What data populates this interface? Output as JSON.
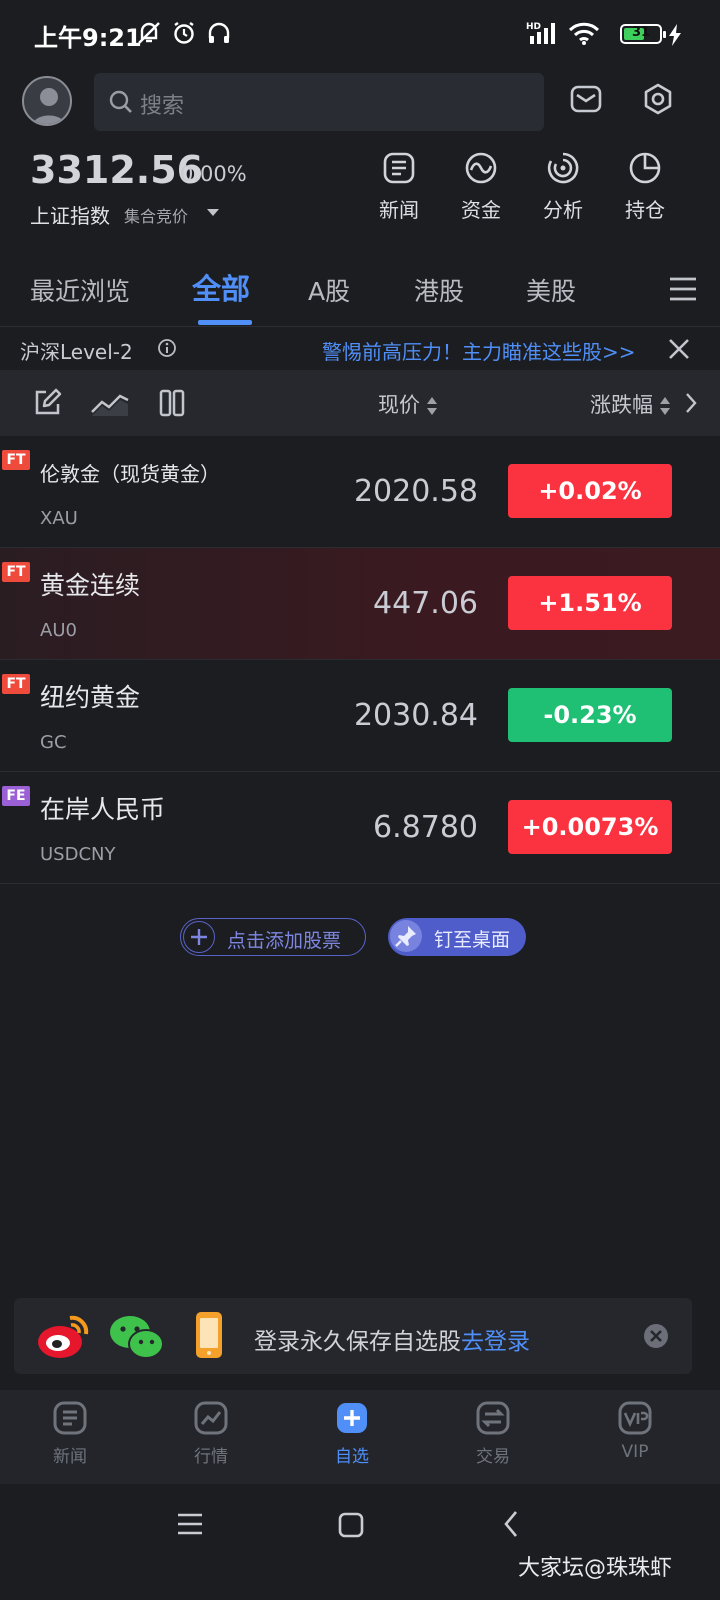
{
  "status_bar": {
    "time": "上午9:21",
    "signal": "HD",
    "battery": "31"
  },
  "header": {
    "search_placeholder": "搜索"
  },
  "index": {
    "value": "3312.56",
    "change": "0.00%",
    "name": "上证指数",
    "session": "集合竞价"
  },
  "quick_links": [
    {
      "label": "新闻",
      "icon": "news-icon"
    },
    {
      "label": "资金",
      "icon": "fund-flow-icon"
    },
    {
      "label": "分析",
      "icon": "analysis-icon"
    },
    {
      "label": "持仓",
      "icon": "holdings-pie-icon"
    }
  ],
  "tabs": [
    {
      "label": "最近浏览"
    },
    {
      "label": "全部",
      "active": true
    },
    {
      "label": "A股"
    },
    {
      "label": "港股"
    },
    {
      "label": "美股"
    }
  ],
  "level2": {
    "label": "沪深Level-2",
    "promo": "警惕前高压力！主力瞄准这些股>>"
  },
  "list_header": {
    "price": "现价",
    "change": "涨跌幅"
  },
  "rows": [
    {
      "tag": "FT",
      "name": "伦敦金（现货黄金）",
      "code": "XAU",
      "price": "2020.58",
      "change": "+0.02%",
      "direction": "up"
    },
    {
      "tag": "FT",
      "name": "黄金连续",
      "code": "AU0",
      "price": "447.06",
      "change": "+1.51%",
      "direction": "up"
    },
    {
      "tag": "FT",
      "name": "纽约黄金",
      "code": "GC",
      "price": "2030.84",
      "change": "-0.23%",
      "direction": "down"
    },
    {
      "tag": "FE",
      "name": "在岸人民币",
      "code": "USDCNY",
      "price": "6.8780",
      "change": "+0.0073%",
      "direction": "up"
    }
  ],
  "actions": {
    "add": "点击添加股票",
    "pin": "钉至桌面"
  },
  "banner": {
    "text": "登录永久保存自选股",
    "link": "去登录"
  },
  "bottom_nav": [
    {
      "label": "新闻"
    },
    {
      "label": "行情"
    },
    {
      "label": "自选",
      "active": true
    },
    {
      "label": "交易"
    },
    {
      "label": "VIP"
    }
  ],
  "watermark": "大家坛@珠珠虾",
  "colors": {
    "up": "#fb3341",
    "down": "#1fbf74",
    "accent": "#4f8ff7",
    "ft_tag": "#ef4b3c",
    "fe_tag": "#9b5fd6"
  }
}
